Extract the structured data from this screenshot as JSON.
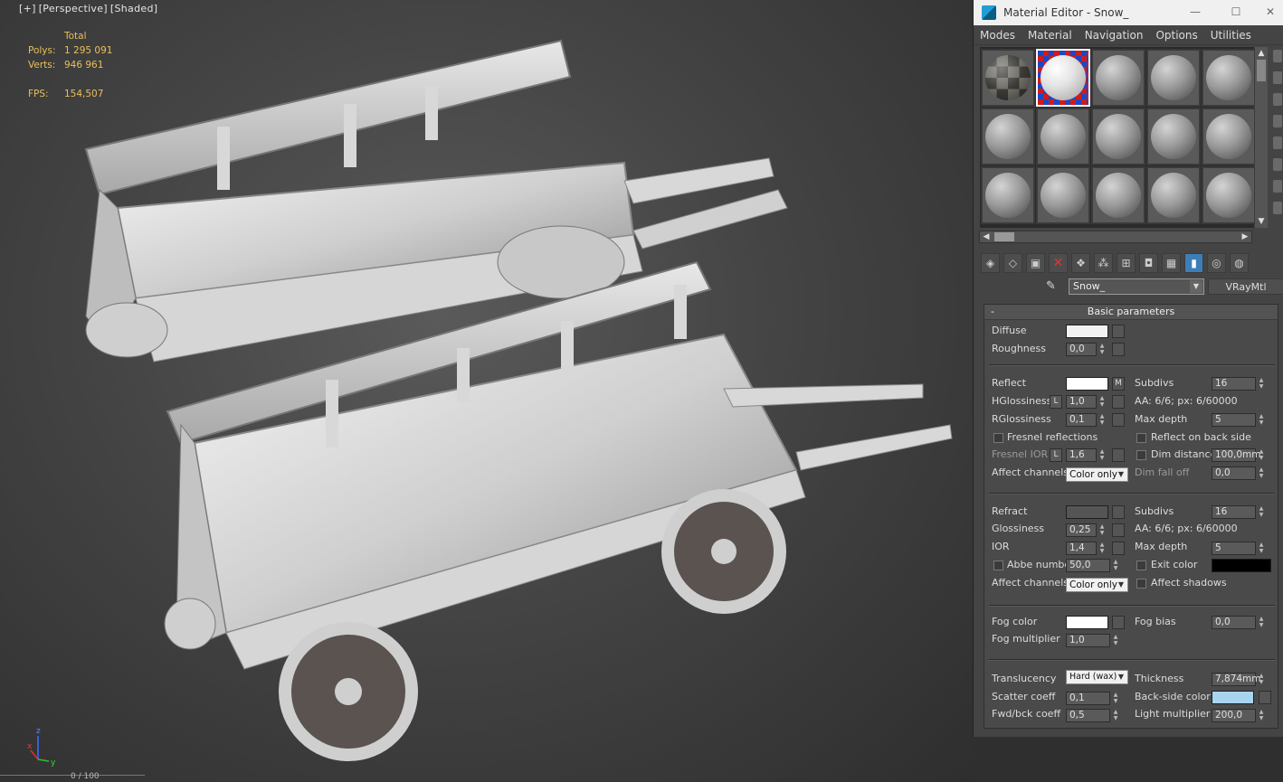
{
  "viewport": {
    "label_parts": [
      "[+]",
      "[Perspective]",
      "[Shaded]"
    ],
    "stats": {
      "total_label": "Total",
      "polys_label": "Polys:",
      "polys_value": "1 295 091",
      "verts_label": "Verts:",
      "verts_value": "946 961",
      "fps_label": "FPS:",
      "fps_value": "154,507"
    },
    "axis_labels": [
      "z",
      "y",
      "x"
    ],
    "timeline_text": "0 / 100"
  },
  "editor": {
    "title": "Material Editor - Snow_",
    "menu": [
      "Modes",
      "Material",
      "Navigation",
      "Options",
      "Utilities"
    ],
    "material_name": "Snow_",
    "material_type": "VRayMtl",
    "panel_title": "Basic parameters",
    "collapse_symbol": "-",
    "diffuse": {
      "label": "Diffuse",
      "color": "#f2f2f2"
    },
    "roughness": {
      "label": "Roughness",
      "value": "0,0"
    },
    "reflect": {
      "label": "Reflect",
      "color": "#ffffff",
      "map_btn": "M"
    },
    "hglossiness": {
      "label": "HGlossiness",
      "lock": "L",
      "value": "1,0"
    },
    "rglossiness": {
      "label": "RGlossiness",
      "value": "0,1"
    },
    "fresnel": {
      "label": "Fresnel reflections"
    },
    "fresnel_ior": {
      "label": "Fresnel IOR",
      "lock": "L",
      "value": "1,6"
    },
    "affect_channels_1": {
      "label": "Affect channels",
      "value": "Color only"
    },
    "refl_subdivs": {
      "label": "Subdivs",
      "value": "16"
    },
    "refl_aa": "AA: 6/6; px: 6/60000",
    "refl_max_depth": {
      "label": "Max depth",
      "value": "5"
    },
    "reflect_back": {
      "label": "Reflect on back side"
    },
    "dim_distance": {
      "label": "Dim distance",
      "value": "100,0mm"
    },
    "dim_falloff": {
      "label": "Dim fall off",
      "value": "0,0"
    },
    "refract": {
      "label": "Refract",
      "color": "#555555"
    },
    "glossiness": {
      "label": "Glossiness",
      "value": "0,25"
    },
    "ior": {
      "label": "IOR",
      "value": "1,4"
    },
    "abbe": {
      "label": "Abbe number",
      "value": "50,0"
    },
    "affect_channels_2": {
      "label": "Affect channels",
      "value": "Color only"
    },
    "refr_subdivs": {
      "label": "Subdivs",
      "value": "16"
    },
    "refr_aa": "AA: 6/6; px: 6/60000",
    "refr_max_depth": {
      "label": "Max depth",
      "value": "5"
    },
    "exit_color": {
      "label": "Exit color",
      "color": "#000000"
    },
    "affect_shadows": {
      "label": "Affect shadows"
    },
    "fog_color": {
      "label": "Fog color",
      "color": "#ffffff"
    },
    "fog_multiplier": {
      "label": "Fog multiplier",
      "value": "1,0"
    },
    "fog_bias": {
      "label": "Fog bias",
      "value": "0,0"
    },
    "translucency": {
      "label": "Translucency",
      "value": "Hard (wax)"
    },
    "scatter_coeff": {
      "label": "Scatter coeff",
      "value": "0,1"
    },
    "fwd_bck": {
      "label": "Fwd/bck coeff",
      "value": "0,5"
    },
    "thickness": {
      "label": "Thickness",
      "value": "7,874mm"
    },
    "back_side_color": {
      "label": "Back-side color",
      "color": "#a8d4f0"
    },
    "light_multiplier": {
      "label": "Light multiplier",
      "value": "200,0"
    }
  }
}
